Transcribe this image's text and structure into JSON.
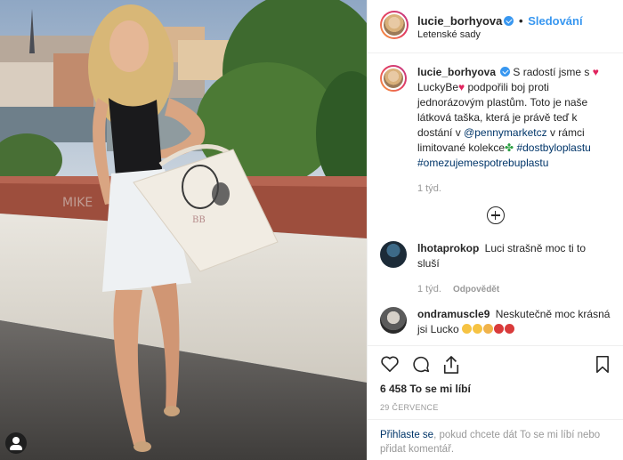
{
  "photo": {
    "tote_logo": "BB",
    "graffiti_text": "MIKE"
  },
  "header": {
    "username": "lucie_borhyova",
    "separator": "•",
    "follow_label": "Sledování",
    "location": "Letenské sady"
  },
  "caption": {
    "username": "lucie_borhyova",
    "text_1": "S radostí jsme s",
    "text_2": "LuckyBe",
    "text_3": "podpořili boj proti jednorázovým plastům. Toto je naše látková taška, která je právě teď k dostání v",
    "mention": "@pennymarketcz",
    "text_4": "v rámci limitované kolekce",
    "hashtag_1": "#dostbyloplastu",
    "hashtag_2": "#omezujemespotrebuplastu",
    "time": "1 týd."
  },
  "comments": [
    {
      "username": "lhotaprokop",
      "text": "Luci strašně moc ti to sluší",
      "time": "1 týd.",
      "reply_label": "Odpovědět"
    },
    {
      "username": "ondramuscle9",
      "text": "Neskutečně moc krásná jsi Lucko"
    }
  ],
  "likes": "6 458 To se mi líbí",
  "date": "29 ČERVENCE",
  "login": {
    "link": "Přihlaste se",
    "text": ", pokud chcete dát To se mi líbí nebo přidat komentář."
  },
  "colors": {
    "accent_link": "#3897f0",
    "hashtag": "#003569",
    "heart": "#e0245e"
  }
}
